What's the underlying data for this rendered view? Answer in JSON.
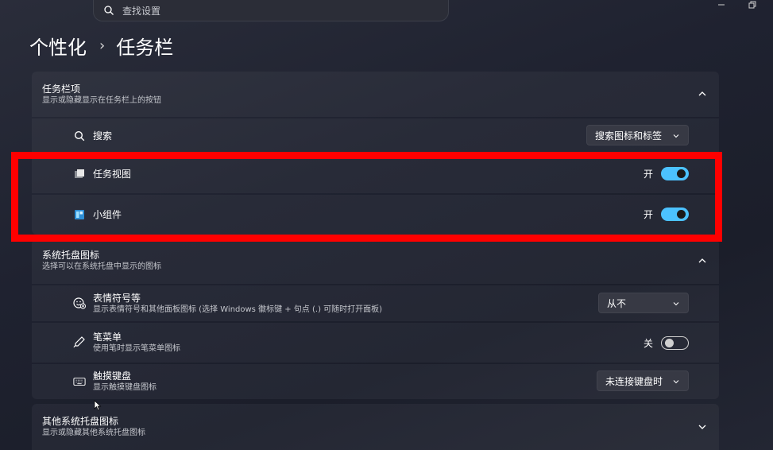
{
  "search": {
    "placeholder": "查找设置"
  },
  "breadcrumb": {
    "parent": "个性化",
    "separator": "›",
    "current": "任务栏"
  },
  "sections": {
    "taskbar_items": {
      "title": "任务栏项",
      "subtitle": "显示或隐藏显示在任务栏上的按钮",
      "expanded": true,
      "rows": {
        "search": {
          "label": "搜索",
          "dropdown": "搜索图标和标签"
        },
        "task_view": {
          "label": "任务视图",
          "state_label": "开",
          "on": true
        },
        "widgets": {
          "label": "小组件",
          "state_label": "开",
          "on": true
        }
      }
    },
    "tray_icons": {
      "title": "系统托盘图标",
      "subtitle": "选择可以在系统托盘中显示的图标",
      "expanded": true,
      "rows": {
        "emoji": {
          "label": "表情符号等",
          "desc": "显示表情符号和其他面板图标 (选择 Windows 徽标键 + 句点 (.) 可随时打开面板)",
          "dropdown": "从不"
        },
        "pen": {
          "label": "笔菜单",
          "desc": "使用笔时显示笔菜单图标",
          "state_label": "关",
          "on": false
        },
        "touch_keyboard": {
          "label": "触摸键盘",
          "desc": "显示触摸键盘图标",
          "dropdown": "未连接键盘时"
        }
      }
    },
    "other_tray": {
      "title": "其他系统托盘图标",
      "subtitle": "显示或隐藏其他系统托盘图标",
      "expanded": false
    }
  },
  "colors": {
    "accent": "#4cc2ff",
    "highlight": "#ff0000"
  }
}
